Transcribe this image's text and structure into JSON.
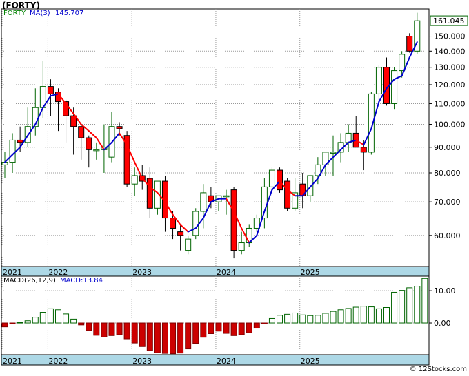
{
  "title": "(FORTY)",
  "legend_main": {
    "symbol": "FORTY",
    "ma_label": "MA(3)",
    "ma_value": "145.707"
  },
  "legend_macd": {
    "label": "MACD(26,12,9)",
    "value_label": "MACD:13.84"
  },
  "footer": "© 12Stocks.com",
  "last_price_label": "161.045",
  "colors": {
    "up": "#006400",
    "down": "#ff0000",
    "ma_up": "#0000cc",
    "ma_down": "#ff0000",
    "macd_pos": "#006400",
    "macd_neg": "#cc0000",
    "axis_band": "#add8e6",
    "grid": "#999999"
  },
  "chart_data": [
    {
      "type": "candlestick",
      "scale": "log",
      "ylim": [
        52,
        170
      ],
      "yticks": [
        "60.000",
        "70.000",
        "80.000",
        "90.000",
        "100.000",
        "110.000",
        "120.000",
        "130.000",
        "140.000",
        "150.000"
      ],
      "ytick_values": [
        60,
        70,
        80,
        90,
        100,
        110,
        120,
        130,
        140,
        150
      ],
      "x_labels": [
        "2021",
        "2022",
        "2023",
        "2024",
        "2025"
      ],
      "x_label_index": [
        0,
        6,
        17,
        28,
        39
      ],
      "ohlc": [
        [
          83,
          88,
          78,
          84
        ],
        [
          84,
          96,
          80,
          93
        ],
        [
          93,
          99,
          88,
          92
        ],
        [
          92,
          108,
          90,
          99
        ],
        [
          99,
          118,
          95,
          108
        ],
        [
          108,
          134,
          103,
          119
        ],
        [
          119,
          123,
          104,
          115
        ],
        [
          116,
          118,
          97,
          111
        ],
        [
          111,
          112,
          92,
          104
        ],
        [
          104,
          108,
          87,
          99
        ],
        [
          99,
          100,
          85,
          94
        ],
        [
          94,
          95,
          82,
          89
        ],
        [
          89,
          92,
          85,
          89
        ],
        [
          89,
          100,
          80,
          90
        ],
        [
          86,
          106,
          84,
          99
        ],
        [
          99,
          101,
          95,
          98
        ],
        [
          95,
          97,
          75,
          76
        ],
        [
          76,
          82,
          72,
          79
        ],
        [
          79,
          83,
          74,
          77
        ],
        [
          78,
          82,
          65,
          68
        ],
        [
          68,
          77,
          66,
          77
        ],
        [
          77,
          79,
          61,
          65
        ],
        [
          65,
          67,
          59,
          62
        ],
        [
          61,
          63,
          56,
          60
        ],
        [
          56,
          60,
          55,
          59
        ],
        [
          60,
          68,
          59,
          67
        ],
        [
          67,
          76,
          62,
          73
        ],
        [
          72,
          75,
          68,
          70
        ],
        [
          70,
          72,
          67,
          72
        ],
        [
          72,
          74,
          66,
          72
        ],
        [
          74,
          75,
          54,
          56
        ],
        [
          56,
          61,
          55,
          58
        ],
        [
          58,
          63,
          57,
          62
        ],
        [
          62,
          66,
          61,
          65
        ],
        [
          65,
          78,
          62,
          75
        ],
        [
          75,
          82,
          72,
          81
        ],
        [
          81,
          82,
          73,
          74
        ],
        [
          77,
          78,
          67,
          68
        ],
        [
          68,
          78,
          67,
          73
        ],
        [
          76,
          80,
          68,
          72
        ],
        [
          72,
          79,
          70,
          79
        ],
        [
          79,
          86,
          76,
          83
        ],
        [
          83,
          88,
          79,
          88
        ],
        [
          88,
          95,
          79,
          88
        ],
        [
          88,
          96,
          84,
          92
        ],
        [
          92,
          100,
          88,
          96
        ],
        [
          96,
          104,
          92,
          90
        ],
        [
          90,
          93,
          81,
          88
        ],
        [
          88,
          116,
          87,
          115
        ],
        [
          115,
          131,
          110,
          130
        ],
        [
          130,
          136,
          109,
          110
        ],
        [
          110,
          130,
          107,
          128
        ],
        [
          128,
          140,
          124,
          138
        ],
        [
          150,
          152,
          139,
          140
        ],
        [
          140,
          167,
          138,
          161
        ]
      ],
      "ma": {
        "name": "MA(3)",
        "values": [
          84,
          87,
          90,
          95,
          100,
          108,
          114,
          115,
          110,
          105,
          100,
          97,
          94,
          89,
          92,
          96,
          91,
          84,
          78,
          75,
          73,
          70,
          66,
          63,
          61,
          62,
          65,
          70,
          71,
          71,
          67,
          62,
          58,
          60,
          67,
          74,
          77,
          74,
          72,
          72,
          75,
          78,
          83,
          86,
          89,
          92,
          93,
          91,
          98,
          111,
          118,
          123,
          125,
          136,
          146
        ]
      }
    },
    {
      "type": "bar",
      "name": "MACD(26,12,9)",
      "ylim": [
        -9.8,
        14.5
      ],
      "yticks": [
        "10.00",
        "0.00"
      ],
      "ytick_values": [
        10,
        0
      ],
      "x_labels": [
        "2021",
        "2022",
        "2023",
        "2024",
        "2025"
      ],
      "values": [
        -1.2,
        -0.3,
        0.2,
        0.7,
        1.8,
        3.3,
        4.4,
        4.1,
        2.8,
        1.2,
        -0.6,
        -2.3,
        -3.8,
        -4.3,
        -3.9,
        -3.6,
        -4.9,
        -6.2,
        -7.3,
        -8.5,
        -9.2,
        -9.4,
        -9.5,
        -9.3,
        -8.0,
        -6.3,
        -4.4,
        -3.3,
        -2.5,
        -3.2,
        -3.9,
        -3.6,
        -3.0,
        -1.6,
        -0.3,
        1.4,
        2.4,
        2.7,
        3.1,
        2.5,
        2.3,
        2.4,
        3.0,
        3.6,
        4.1,
        4.5,
        4.9,
        5.2,
        5.0,
        4.4,
        4.8,
        9.5,
        10.1,
        10.9,
        11.4,
        13.8
      ]
    }
  ]
}
